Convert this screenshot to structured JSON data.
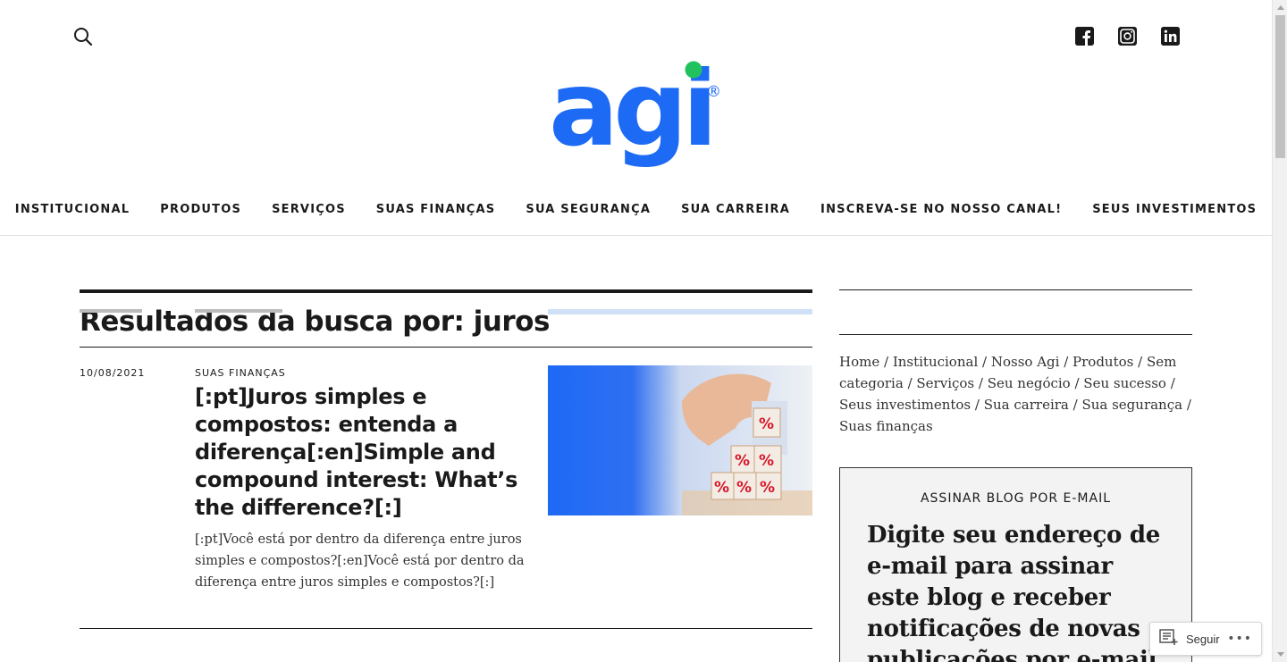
{
  "header": {
    "social": [
      {
        "name": "facebook",
        "glyph": "f"
      },
      {
        "name": "instagram",
        "glyph": ""
      },
      {
        "name": "linkedin",
        "glyph": "in"
      }
    ],
    "logo_text": "agi",
    "logo_mark": "®",
    "brand_blue": "#1d6af5",
    "brand_green": "#21c25e"
  },
  "nav": {
    "items": [
      "INSTITUCIONAL",
      "PRODUTOS",
      "SERVIÇOS",
      "SUAS FINANÇAS",
      "SUA SEGURANÇA",
      "SUA CARREIRA",
      "INSCREVA-SE NO NOSSO CANAL!",
      "SEUS INVESTIMENTOS"
    ]
  },
  "main": {
    "title": "Resultados da busca por: juros",
    "posts": [
      {
        "date": "10/08/2021",
        "category": "SUAS FINANÇAS",
        "title": "[:pt]Juros simples e compostos: entenda a diferença[:en]Simple and compound interest: What’s the difference?[:]",
        "excerpt": "[:pt]Você está por dentro da diferença entre juros simples e compostos?[:en]Você está por dentro da diferença entre juros simples e compostos?[:]"
      }
    ]
  },
  "sidebar": {
    "links": [
      "Home",
      "Institucional",
      "Nosso Agi",
      "Produtos",
      "Sem categoria",
      "Serviços",
      "Seu negócio",
      "Seu sucesso",
      "Seus investimentos",
      "Sua carreira",
      "Sua segurança",
      "Suas finanças"
    ],
    "subscribe_title": "ASSINAR BLOG POR E-MAIL",
    "subscribe_text": "Digite seu endereço de e-mail para assinar este blog e receber notificações de novas publicações por e-mail."
  },
  "follow": {
    "label": "Seguir",
    "more": "•••"
  }
}
